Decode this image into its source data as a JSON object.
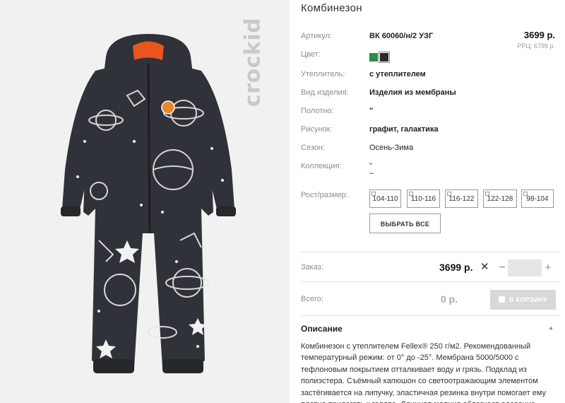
{
  "brand": {
    "logo_text": "crockid"
  },
  "product": {
    "title": "Комбинезон",
    "price": "3699 р.",
    "rrp": "РРЦ: 6799 р."
  },
  "attributes": [
    {
      "label": "Артикул:",
      "value": "ВК 60060/н/2 УЗГ",
      "bold": true
    },
    {
      "label": "Цвет:",
      "value": "",
      "bold": false
    },
    {
      "label": "Утеплитель:",
      "value": "с утеплителем",
      "bold": true
    },
    {
      "label": "Вид изделия:",
      "value": "Изделия из мембраны",
      "bold": true
    },
    {
      "label": "Полотно:",
      "value": "\"",
      "bold": true
    },
    {
      "label": "Рисунок:",
      "value": "графит, галактика",
      "bold": true
    },
    {
      "label": "Сезон:",
      "value": "Осень-Зима",
      "bold": false
    },
    {
      "label": "Коллекция:",
      "value": "\"",
      "bold": false
    }
  ],
  "collection_extra": "–",
  "colors": {
    "swatch_1": "#2e8b4a",
    "swatch_2": "#2a2a2a"
  },
  "sizes": {
    "label": "Рост/размер:",
    "options": [
      "104-110",
      "110-116",
      "116-122",
      "122-128",
      "98-104"
    ],
    "select_all": "ВЫБРАТЬ ВСЕ"
  },
  "order": {
    "label": "Заказ:",
    "price": "3699 р.",
    "times": "✕",
    "minus": "−",
    "plus": "+",
    "qty_value": ""
  },
  "total": {
    "label": "Всего:",
    "price": "0 р.",
    "cart_button": "В КОРЗИНУ"
  },
  "description": {
    "title": "Описание",
    "caret": "▲",
    "text": "Комбинезон с утеплителем Fellex® 250 г/м2. Рекомендованный температурный режим: от 0° до -25°. Мембрана 5000/5000 с тефлоновым покрытием отталкивает воду и грязь. Подклад из полиэстера. Съёмный капюшон со светоотражающим элементом застёгивается на липучку, эластичная резинка внутри помогает ему плотно прилегать к голове. Длинная молния облегчает одевание."
  }
}
